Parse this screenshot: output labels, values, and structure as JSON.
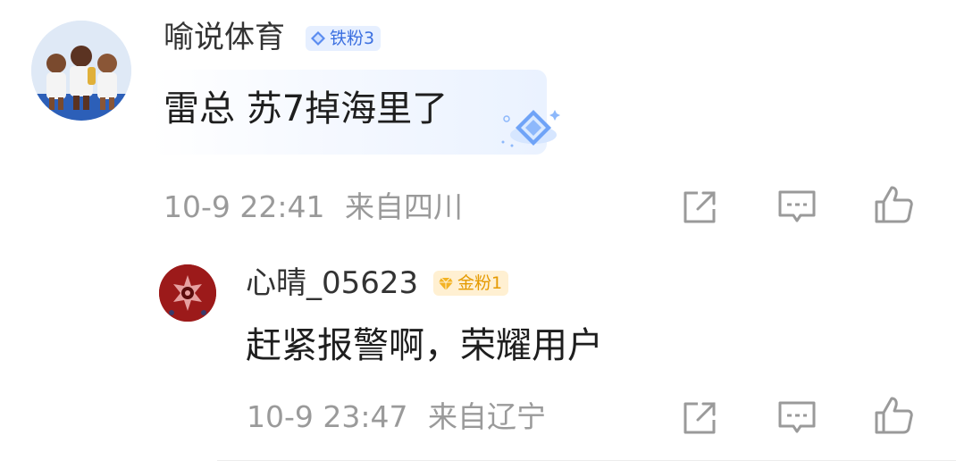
{
  "comment": {
    "user": {
      "name": "喻说体育",
      "badge": "铁粉3",
      "badge_color": "#3b6fe0"
    },
    "text": "雷总 苏7掉海里了",
    "time": "10-9 22:41",
    "location": "来自四川",
    "actions": [
      "share-icon",
      "comment-icon",
      "like-icon"
    ]
  },
  "reply": {
    "user": {
      "name": "心晴_05623",
      "badge": "金粉1",
      "badge_color": "#e59a00"
    },
    "text": "赶紧报警啊，荣耀用户",
    "time": "10-9 23:47",
    "location": "来自辽宁",
    "actions": [
      "share-icon",
      "comment-icon",
      "like-icon"
    ]
  }
}
